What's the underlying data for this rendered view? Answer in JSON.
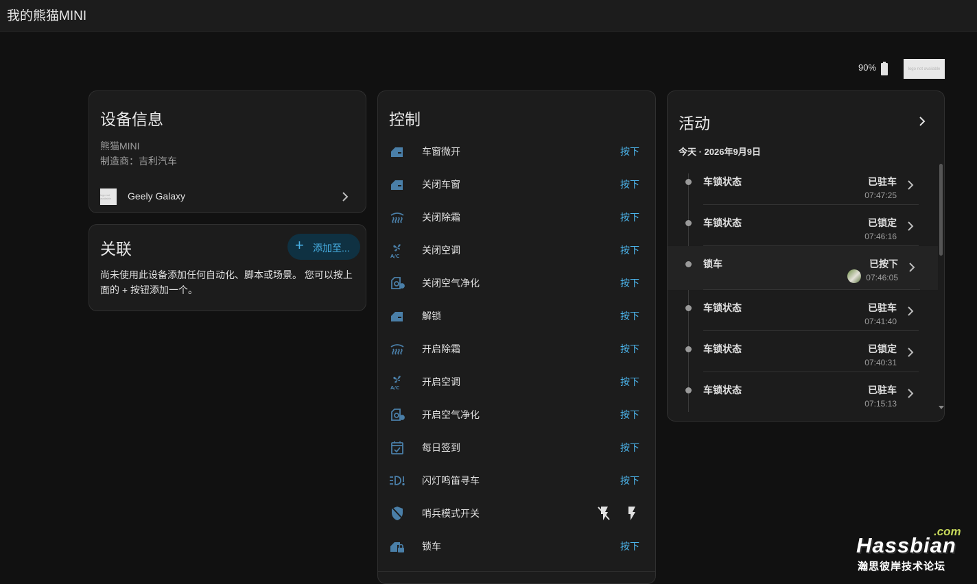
{
  "header": {
    "title": "我的熊猫MINI"
  },
  "status": {
    "battery": "90%",
    "logo_alt": "logo not available"
  },
  "device_info": {
    "title": "设备信息",
    "model": "熊猫MINI",
    "manufacturer": "制造商：吉利汽车",
    "linked_device": "Geely Galaxy",
    "thumb_alt": "logo not available"
  },
  "related": {
    "title": "关联",
    "add_button": "添加至...",
    "description": "尚未使用此设备添加任何自动化、脚本或场景。 您可以按上面的 + 按钮添加一个。"
  },
  "controls": {
    "title": "控制",
    "items": [
      {
        "label": "车窗微开",
        "action": "按下",
        "icon": "car-door-icon"
      },
      {
        "label": "关闭车窗",
        "action": "按下",
        "icon": "car-door-icon"
      },
      {
        "label": "关闭除霜",
        "action": "按下",
        "icon": "defrost-icon"
      },
      {
        "label": "关闭空调",
        "action": "按下",
        "icon": "ac-fan-icon"
      },
      {
        "label": "关闭空气净化",
        "action": "按下",
        "icon": "air-purifier-icon"
      },
      {
        "label": "解锁",
        "action": "按下",
        "icon": "car-door-icon"
      },
      {
        "label": "开启除霜",
        "action": "按下",
        "icon": "defrost-icon"
      },
      {
        "label": "开启空调",
        "action": "按下",
        "icon": "ac-fan-icon"
      },
      {
        "label": "开启空气净化",
        "action": "按下",
        "icon": "air-purifier-icon"
      },
      {
        "label": "每日签到",
        "action": "按下",
        "icon": "calendar-check-icon"
      },
      {
        "label": "闪灯鸣笛寻车",
        "action": "按下",
        "icon": "headlight-alert-icon"
      },
      {
        "label": "哨兵模式开关",
        "action": "",
        "icon": "shield-car-icon"
      },
      {
        "label": "锁车",
        "action": "按下",
        "icon": "car-door-lock-icon"
      }
    ]
  },
  "activity": {
    "title": "活动",
    "date": "今天 · 2026年9月9日",
    "items": [
      {
        "name": "车锁状态",
        "state": "已驻车",
        "time": "07:47:25"
      },
      {
        "name": "车锁状态",
        "state": "已锁定",
        "time": "07:46:16"
      },
      {
        "name": "锁车",
        "state": "已按下",
        "time": "07:46:05"
      },
      {
        "name": "车锁状态",
        "state": "已驻车",
        "time": "07:41:40"
      },
      {
        "name": "车锁状态",
        "state": "已锁定",
        "time": "07:40:31"
      },
      {
        "name": "车锁状态",
        "state": "已驻车",
        "time": "07:15:13"
      }
    ]
  },
  "watermark": {
    "main": "Hassbian",
    "com": ".com",
    "sub": "瀚思彼岸技术论坛"
  },
  "colors": {
    "accent": "#4cb5ec",
    "icon": "#4a7fa8",
    "background": "#111111",
    "card": "#1c1c1c"
  }
}
